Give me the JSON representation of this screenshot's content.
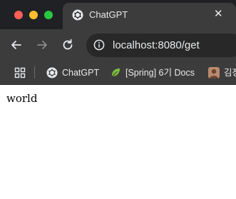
{
  "window": {
    "tab": {
      "title": "ChatGPT",
      "close_glyph": "✕",
      "favicon": "chatgpt-logo-icon"
    },
    "controls": [
      "close",
      "minimize",
      "maximize"
    ]
  },
  "toolbar": {
    "back_icon": "arrow-left-icon",
    "forward_icon": "arrow-right-icon",
    "reload_icon": "reload-icon",
    "site_info_icon": "info-icon",
    "url": "localhost:8080/get"
  },
  "bookmarks": {
    "apps_icon": "apps-grid-icon",
    "items": [
      {
        "label": "ChatGPT",
        "icon": "chatgpt-logo-icon"
      },
      {
        "label": "[Spring] 6기 Docs",
        "icon": "leaf-icon"
      },
      {
        "label": "김장",
        "icon": "avatar-icon"
      }
    ]
  },
  "page": {
    "body_text": "world"
  },
  "colors": {
    "tabbar": "#202124",
    "toolbar": "#3c3c3c",
    "omnibox": "#282828",
    "traffic_red": "#fe5f57",
    "traffic_yellow": "#febc2e",
    "traffic_green": "#28c840",
    "leaf_green": "#7cbf3a"
  }
}
